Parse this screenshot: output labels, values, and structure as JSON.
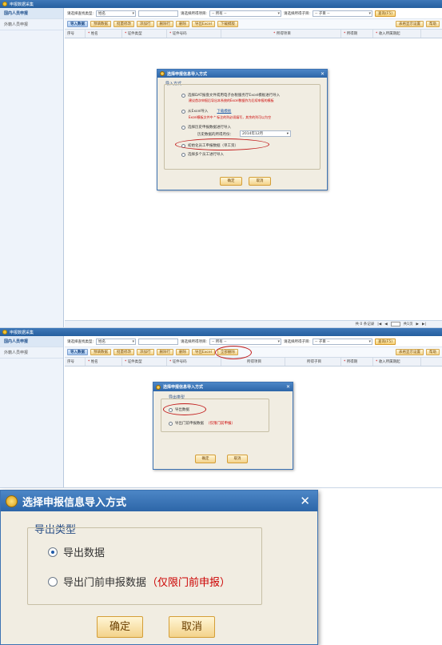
{
  "app": {
    "title": "申报数据采集"
  },
  "sidebar": {
    "items": [
      {
        "label": "国内人员申报"
      },
      {
        "label": "外籍人员申报"
      }
    ]
  },
  "filters": {
    "query_type_label": "请选择查找类型:",
    "query_type_value": "姓名",
    "period_label": "请选择所得项目:",
    "period_value": "-- 所有 --",
    "subitem_label": "请选择所得子目:",
    "subitem_value": "-- 子目 --",
    "query_button": "查询(F5)"
  },
  "toolbar1": {
    "buttons": [
      "导入数据",
      "预填数据",
      "批量修改",
      "添加行",
      "删除行",
      "删除",
      "导出Excel",
      "下载模版"
    ],
    "right_buttons": [
      "表格显示设置",
      "帮助"
    ]
  },
  "toolbar2": {
    "buttons": [
      "导入数据",
      "预填数据",
      "批量修改",
      "添加行",
      "删除行",
      "删除",
      "导出Excel",
      "全部删除"
    ],
    "right_buttons": [
      "表格显示设置",
      "帮助"
    ]
  },
  "table": {
    "columns1": [
      "序号",
      "姓名",
      "证件类型",
      "证件号码",
      "所得项目",
      "所得期",
      "收入额",
      "所得期间",
      "收入所属期起"
    ],
    "columns2": [
      "序号",
      "姓名",
      "证件类型",
      "证件号码",
      "所得项目",
      "所得子目",
      "所得期",
      "收入所属期起"
    ]
  },
  "pager": {
    "text": "共 0 条记录",
    "page_text": "共1页"
  },
  "import_dialog": {
    "title": "选择申报信息导入方式",
    "group_label": "导入方式",
    "options": [
      {
        "label": "选择DAT报盘文件或用电子办税服务厅Excel模板进行导入",
        "hint": "建议首次申报后导出本系统的Excel数据作为后续申报的模板",
        "selected": false
      },
      {
        "label": "从Excel导入",
        "link": "下载模板",
        "hint": "Excel模板文件中 * 标注的列必须填写，其余的列可以为空",
        "selected": false
      },
      {
        "label": "选择历史申报数据进行导入",
        "sub_label": "历史数据的所得月份：",
        "month": "2014年12月",
        "selected": false
      },
      {
        "label": "初始化员工申报数据（单工资）",
        "selected": true
      },
      {
        "label": "选择多个员工进行导入",
        "selected": false
      }
    ],
    "ok": "确定",
    "cancel": "取消"
  },
  "export_dialog": {
    "title": "选择申报信息导入方式",
    "group_label": "导出类型",
    "options": [
      {
        "label": "导出数据",
        "selected": true
      },
      {
        "label": "导出门前申报数据",
        "hint": "（仅限门前申报）",
        "selected": false
      }
    ],
    "ok": "确定",
    "cancel": "取消"
  },
  "colors": {
    "accent_red": "#c21c1c",
    "title_blue": "#2d66a8"
  }
}
